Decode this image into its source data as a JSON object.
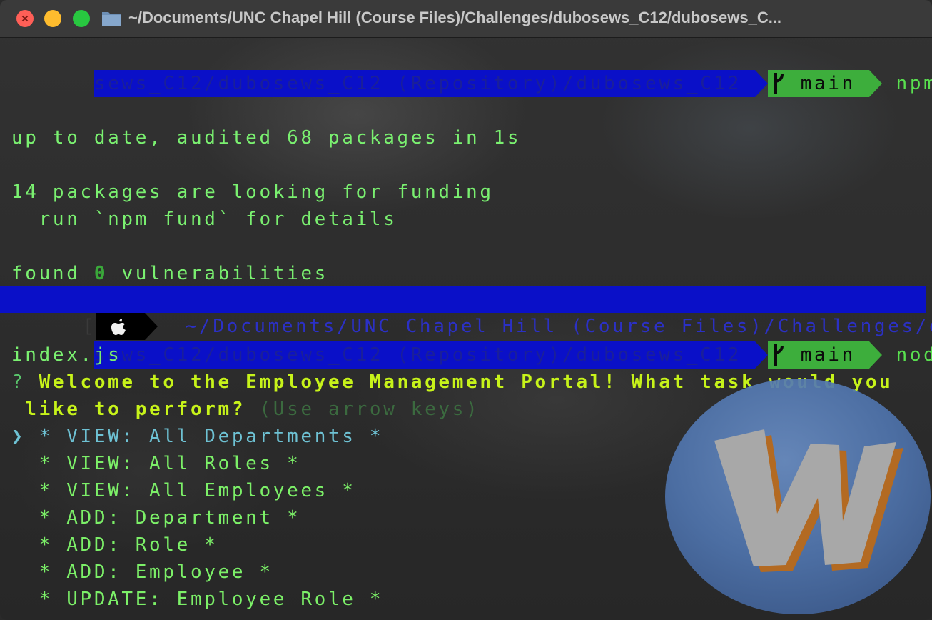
{
  "window": {
    "title": "~/Documents/UNC Chapel Hill (Course Files)/Challenges/dubosews_C12/dubosews_C..."
  },
  "terminal": {
    "line1_path": "sews_C12/dubosews_C12 (Repository)/dubosews_C12 ",
    "line1_branch": " main ",
    "line1_cmd": " npm i",
    "audit": "up to date, audited 68 packages in 1s",
    "funding": "14 packages are looking for funding",
    "fund_hint": "  run `npm fund` for details",
    "found_pre": "found ",
    "found_num": "0",
    "found_post": " vulnerabilities",
    "prompt_bracket_left": "[",
    "prompt_path": "  ~/Documents/UNC Chapel Hill (Course Files)/Challenges/dubo",
    "prompt_bracket_right": "]",
    "line2_path": "sews_C12/dubosews_C12 (Repository)/dubosews_C12 ",
    "line2_branch": " main ",
    "line2_cmd": " node",
    "line2_cont": "index.js",
    "q_mark": "?",
    "question_line1": " Welcome to the Employee Management Portal! What task would you",
    "question_line2": " like to perform?",
    "question_hint": " (Use arrow keys)",
    "cursor": "❯",
    "menu": [
      {
        "label": "* VIEW: All Departments *"
      },
      {
        "label": "* VIEW: All Roles *"
      },
      {
        "label": "* VIEW: All Employees *"
      },
      {
        "label": "* ADD: Department *"
      },
      {
        "label": "* ADD: Role *"
      },
      {
        "label": "* ADD: Employee *"
      },
      {
        "label": "* UPDATE: Employee Role *"
      }
    ]
  },
  "colors": {
    "terminal_green": "#7af070",
    "powerline_blue": "#0a10c8",
    "powerline_green": "#3dae3c",
    "question_yellow": "#c7f31a",
    "selected_cyan": "#6ec2d4"
  },
  "icons": [
    "folder-icon",
    "git-branch-icon",
    "apple-icon",
    "w-logo-badge"
  ]
}
